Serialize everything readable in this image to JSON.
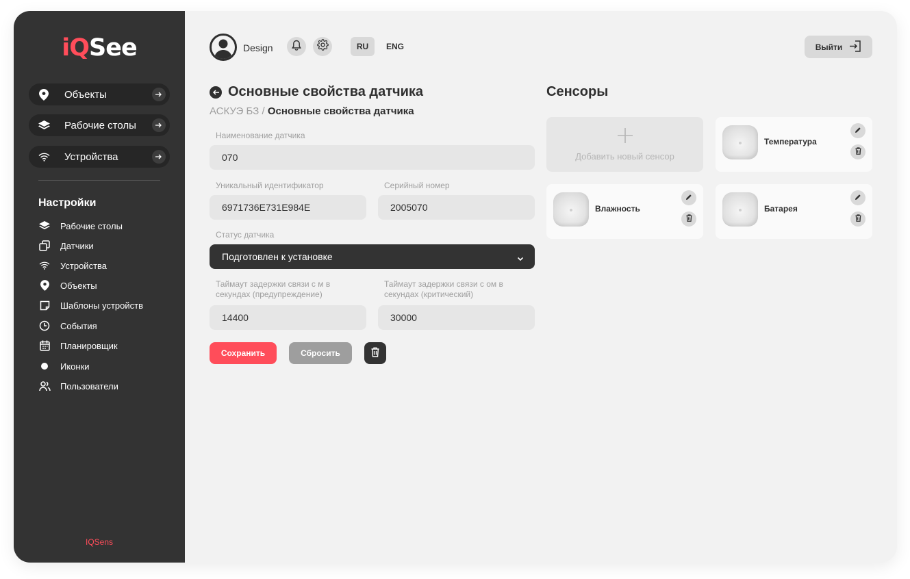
{
  "brand": {
    "logo_iq": "iQ",
    "logo_see": "See",
    "footer": "IQSens"
  },
  "sidebar": {
    "main_nav": [
      {
        "label": "Объекты",
        "icon": "location-pin-icon"
      },
      {
        "label": "Рабочие столы",
        "icon": "layers-icon"
      },
      {
        "label": "Устройства",
        "icon": "wifi-icon"
      }
    ],
    "settings_title": "Настройки",
    "settings_nav": [
      {
        "label": "Рабочие столы",
        "icon": "layers-icon"
      },
      {
        "label": "Датчики",
        "icon": "sensor-squares-icon"
      },
      {
        "label": "Устройства",
        "icon": "wifi-icon"
      },
      {
        "label": "Объекты",
        "icon": "location-pin-icon"
      },
      {
        "label": "Шаблоны устройств",
        "icon": "note-template-icon"
      },
      {
        "label": "События",
        "icon": "clock-icon"
      },
      {
        "label": "Планировщик",
        "icon": "calendar-icon"
      },
      {
        "label": "Иконки",
        "icon": "circle-icon"
      },
      {
        "label": "Пользователи",
        "icon": "users-icon"
      }
    ]
  },
  "header": {
    "username": "Design",
    "languages": [
      {
        "label": "RU",
        "active": true
      },
      {
        "label": "ENG",
        "active": false
      }
    ],
    "logout_label": "Выйти"
  },
  "form": {
    "title": "Основные свойства датчика",
    "breadcrumb": {
      "parent": "АСКУЭ БЗ",
      "separator": " / ",
      "current": "Основные свойства датчика"
    },
    "name_label": "Наименование датчика",
    "name_value": "070",
    "uid_label": "Уникальный идентификатор",
    "uid_value": "6971736E731E984E",
    "serial_label": "Серийный номер",
    "serial_value": "2005070",
    "status_label": "Статус датчика",
    "status_value": "Подготовлен к установке",
    "timeout_warn_label_1": "Таймаут задержки связи с м в",
    "timeout_warn_label_2": "секундах (предупреждение)",
    "timeout_warn_value": "14400",
    "timeout_crit_label_1": "Таймаут задержки связи с ом в",
    "timeout_crit_label_2": "секундах (критический)",
    "timeout_crit_value": "30000",
    "save_label": "Сохранить",
    "reset_label": "Сбросить"
  },
  "sensors": {
    "title": "Сенсоры",
    "add_label": "Добавить новый сенсор",
    "items": [
      {
        "name": "Температура"
      },
      {
        "name": "Влажность"
      },
      {
        "name": "Батарея"
      }
    ]
  },
  "colors": {
    "accent": "#ff4d5a",
    "sidebar": "#333333",
    "background": "#f2f2f2"
  }
}
